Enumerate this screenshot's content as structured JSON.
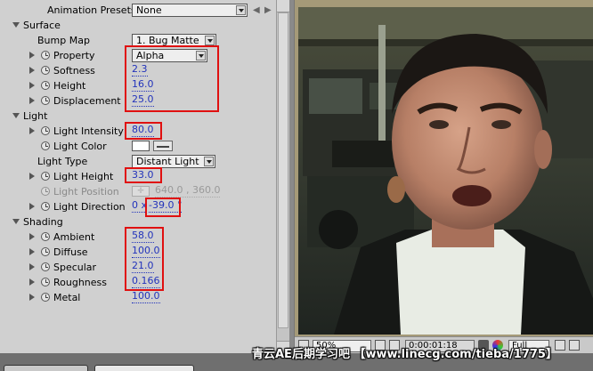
{
  "panel": {
    "animation_presets": {
      "label": "Animation Presets:",
      "value": "None"
    },
    "surface": {
      "title": "Surface",
      "bump_map": {
        "label": "Bump Map",
        "value": "1. Bug Matte"
      },
      "property": {
        "label": "Property",
        "value": "Alpha"
      },
      "softness": {
        "label": "Softness",
        "value": "2.3"
      },
      "height": {
        "label": "Height",
        "value": "16.0"
      },
      "displacement": {
        "label": "Displacement",
        "value": "25.0"
      }
    },
    "light": {
      "title": "Light",
      "light_intensity": {
        "label": "Light Intensity",
        "value": "80.0"
      },
      "light_color": {
        "label": "Light Color",
        "swatch": "#ffffff"
      },
      "light_type": {
        "label": "Light Type",
        "value": "Distant Light"
      },
      "light_height": {
        "label": "Light Height",
        "value": "33.0"
      },
      "light_position": {
        "label": "Light Position",
        "value": "640.0 , 360.0"
      },
      "light_direction": {
        "label": "Light Direction",
        "turns": "0 x",
        "value": "-39.0 °"
      }
    },
    "shading": {
      "title": "Shading",
      "ambient": {
        "label": "Ambient",
        "value": "58.0"
      },
      "diffuse": {
        "label": "Diffuse",
        "value": "100.0"
      },
      "specular": {
        "label": "Specular",
        "value": "21.0"
      },
      "roughness": {
        "label": "Roughness",
        "value": "0.166"
      },
      "metal": {
        "label": "Metal",
        "value": "100.0"
      }
    }
  },
  "viewer_toolbar": {
    "zoom": "50%",
    "timecode": "0:00:01:18",
    "resolution": "Full"
  },
  "watermark": "青云AE后期学习吧 【www.linecg.com/tieba/1775】",
  "colors": {
    "highlight_box": "#e01010",
    "value_blue": "#2233bb",
    "panel_bg": "#d0d0d0"
  }
}
